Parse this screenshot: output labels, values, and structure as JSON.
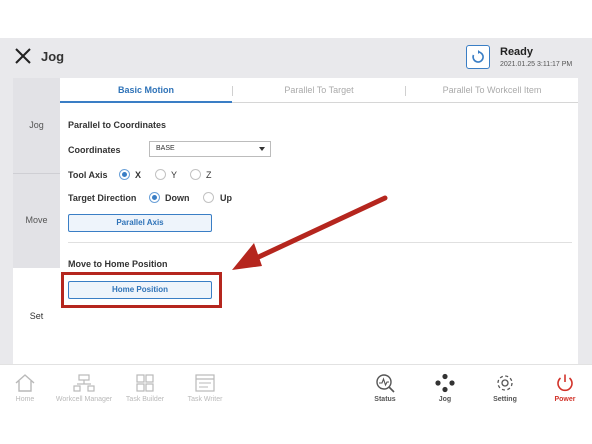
{
  "header": {
    "title": "Jog",
    "status": "Ready",
    "datetime": "2021.01.25 3:11:17 PM"
  },
  "rail": {
    "items": [
      {
        "label": "Jog"
      },
      {
        "label": "Move"
      },
      {
        "label": "Set"
      }
    ]
  },
  "tabs": [
    {
      "label": "Basic Motion",
      "active": true
    },
    {
      "label": "Parallel To Target",
      "active": false
    },
    {
      "label": "Parallel To Workcell Item",
      "active": false
    }
  ],
  "parallel_section": {
    "title": "Parallel to Coordinates",
    "coordinates_label": "Coordinates",
    "coordinates_value": "BASE",
    "tool_axis_label": "Tool Axis",
    "tool_axis_options": [
      "X",
      "Y",
      "Z"
    ],
    "tool_axis_selected": "X",
    "target_direction_label": "Target Direction",
    "direction_options": [
      "Down",
      "Up"
    ],
    "direction_selected": "Down",
    "parallel_axis_button": "Parallel Axis"
  },
  "home_section": {
    "title": "Move to Home Position",
    "home_button": "Home Position"
  },
  "annotation": {
    "color": "#b5261e"
  },
  "bottom_nav": {
    "items": [
      {
        "label": "Home",
        "icon": "home-icon"
      },
      {
        "label": "Workcell Manager",
        "icon": "workcell-icon"
      },
      {
        "label": "Task Builder",
        "icon": "task-builder-icon"
      },
      {
        "label": "Task Writer",
        "icon": "task-writer-icon"
      },
      {
        "label": "Status",
        "icon": "status-icon"
      },
      {
        "label": "Jog",
        "icon": "jog-icon"
      },
      {
        "label": "Setting",
        "icon": "gear-icon"
      },
      {
        "label": "Power",
        "icon": "power-icon"
      }
    ]
  },
  "colors": {
    "accent": "#3a7ec5",
    "power": "#d2332a",
    "background": "#e9e9ec"
  }
}
